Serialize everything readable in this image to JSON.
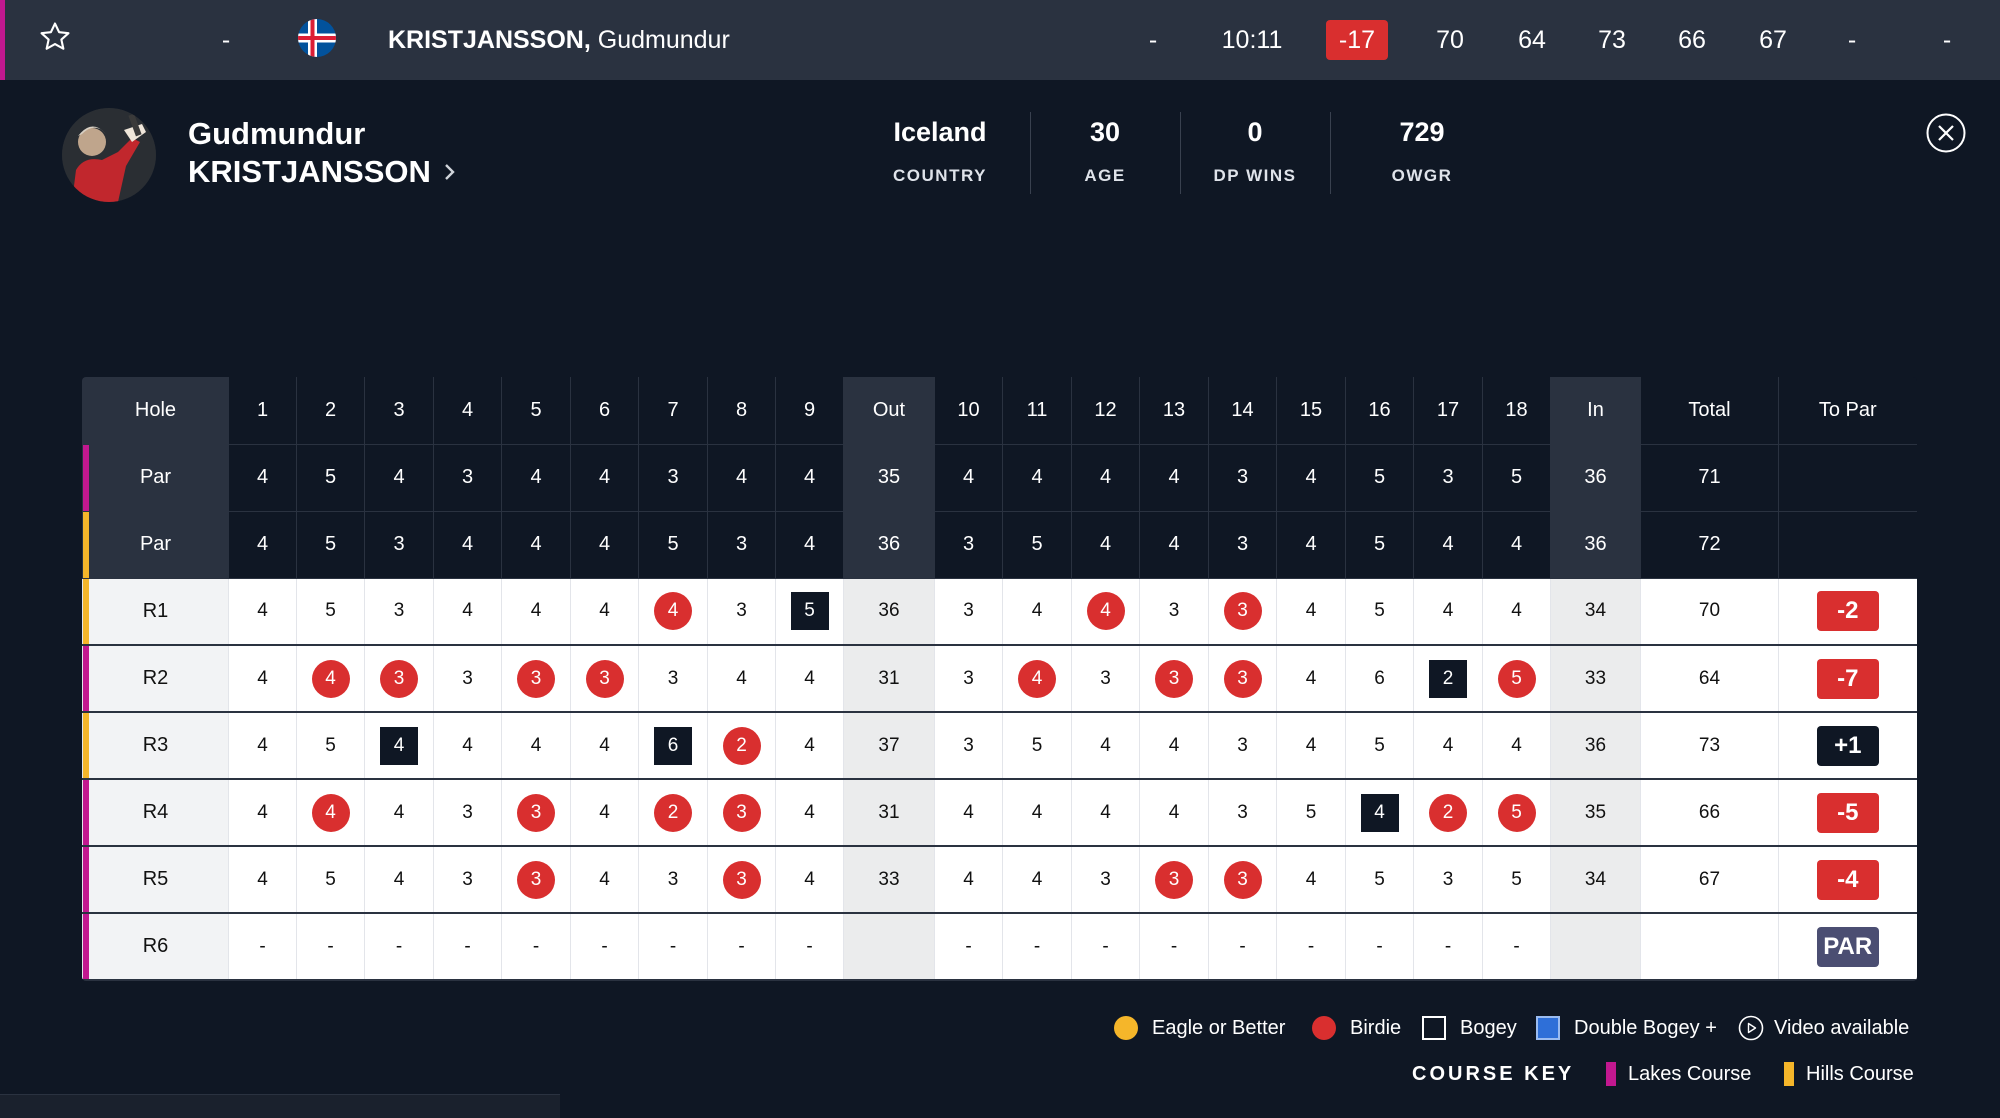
{
  "top_row": {
    "position": "-",
    "name_last": "KRISTJANSSON,",
    "name_first": "Gudmundur",
    "thru": "-",
    "time": "10:11",
    "to_par": "-17",
    "r1": "70",
    "r2": "64",
    "r3": "73",
    "r4": "66",
    "r5": "67",
    "r6": "-",
    "total": "-"
  },
  "player": {
    "first_name": "Gudmundur",
    "last_name": "KRISTJANSSON",
    "stats": [
      {
        "value": "Iceland",
        "label": "COUNTRY"
      },
      {
        "value": "30",
        "label": "AGE"
      },
      {
        "value": "0",
        "label": "DP WINS"
      },
      {
        "value": "729",
        "label": "OWGR"
      }
    ]
  },
  "scorecard": {
    "header": [
      "Hole",
      "1",
      "2",
      "3",
      "4",
      "5",
      "6",
      "7",
      "8",
      "9",
      "Out",
      "10",
      "11",
      "12",
      "13",
      "14",
      "15",
      "16",
      "17",
      "18",
      "In",
      "Total",
      "To Par"
    ],
    "par_rows": [
      {
        "label": "Par",
        "course": "lakes",
        "cells": [
          "4",
          "5",
          "4",
          "3",
          "4",
          "4",
          "3",
          "4",
          "4",
          "35",
          "4",
          "4",
          "4",
          "4",
          "3",
          "4",
          "5",
          "3",
          "5",
          "36",
          "71",
          ""
        ]
      },
      {
        "label": "Par",
        "course": "hills",
        "cells": [
          "4",
          "5",
          "3",
          "4",
          "4",
          "4",
          "5",
          "3",
          "4",
          "36",
          "3",
          "5",
          "4",
          "4",
          "3",
          "4",
          "5",
          "4",
          "4",
          "36",
          "72",
          ""
        ]
      }
    ],
    "rounds": [
      {
        "label": "R1",
        "course": "hills",
        "cells": [
          "4",
          "5",
          "3",
          "4",
          "4",
          "4",
          "4",
          "3",
          "5",
          "36",
          "3",
          "4",
          "4",
          "3",
          "3",
          "4",
          "5",
          "4",
          "4",
          "34",
          "70"
        ],
        "marks": [
          "",
          "",
          "",
          "",
          "",
          "",
          "b",
          "",
          "g",
          "",
          "",
          "b",
          "",
          "b",
          "",
          "",
          "",
          "",
          ""
        ],
        "to_par": "-2",
        "tp": "under"
      },
      {
        "label": "R2",
        "course": "lakes",
        "cells": [
          "4",
          "4",
          "3",
          "3",
          "3",
          "3",
          "3",
          "4",
          "4",
          "31",
          "3",
          "4",
          "3",
          "3",
          "3",
          "4",
          "6",
          "2",
          "5",
          "33",
          "64"
        ],
        "marks": [
          "",
          "b",
          "b",
          "",
          "b",
          "b",
          "",
          "",
          "",
          "",
          "b",
          "",
          "b",
          "b",
          "",
          "",
          "g",
          "b",
          ""
        ],
        "to_par": "-7",
        "tp": "under"
      },
      {
        "label": "R3",
        "course": "hills",
        "cells": [
          "4",
          "5",
          "4",
          "4",
          "4",
          "4",
          "6",
          "2",
          "4",
          "37",
          "3",
          "5",
          "4",
          "4",
          "3",
          "4",
          "5",
          "4",
          "4",
          "36",
          "73"
        ],
        "marks": [
          "",
          "",
          "g",
          "",
          "",
          "",
          "g",
          "b",
          "",
          "",
          "",
          "",
          "",
          "",
          "",
          "",
          "",
          "",
          ""
        ],
        "to_par": "+1",
        "tp": "over"
      },
      {
        "label": "R4",
        "course": "lakes",
        "cells": [
          "4",
          "4",
          "4",
          "3",
          "3",
          "4",
          "2",
          "3",
          "4",
          "31",
          "4",
          "4",
          "4",
          "4",
          "3",
          "5",
          "4",
          "2",
          "5",
          "35",
          "66"
        ],
        "marks": [
          "",
          "b",
          "",
          "",
          "b",
          "",
          "b",
          "b",
          "",
          "",
          "",
          "",
          "",
          "",
          "",
          "g",
          "b",
          "b",
          ""
        ],
        "to_par": "-5",
        "tp": "under"
      },
      {
        "label": "R5",
        "course": "lakes",
        "cells": [
          "4",
          "5",
          "4",
          "3",
          "3",
          "4",
          "3",
          "3",
          "4",
          "33",
          "4",
          "4",
          "3",
          "3",
          "3",
          "4",
          "5",
          "3",
          "5",
          "34",
          "67"
        ],
        "marks": [
          "",
          "",
          "",
          "",
          "b",
          "",
          "",
          "b",
          "",
          "",
          "",
          "",
          "b",
          "b",
          "",
          "",
          "",
          "",
          ""
        ],
        "to_par": "-4",
        "tp": "under"
      },
      {
        "label": "R6",
        "course": "lakes",
        "cells": [
          "-",
          "-",
          "-",
          "-",
          "-",
          "-",
          "-",
          "-",
          "-",
          "",
          "-",
          "-",
          "-",
          "-",
          "-",
          "-",
          "-",
          "-",
          "-",
          "",
          ""
        ],
        "marks": [
          "",
          "",
          "",
          "",
          "",
          "",
          "",
          "",
          "",
          "",
          "",
          "",
          "",
          "",
          "",
          "",
          "",
          "",
          ""
        ],
        "to_par": "PAR",
        "tp": "even"
      }
    ]
  },
  "legend": {
    "eagle": "Eagle or Better",
    "birdie": "Birdie",
    "bogey": "Bogey",
    "double_bogey": "Double Bogey +",
    "video": "Video available",
    "course_key": "COURSE KEY",
    "lakes": "Lakes Course",
    "hills": "Hills Course"
  },
  "colors": {
    "lakes": "#c2188f",
    "hills": "#f5b62a",
    "birdie": "#d92f2f",
    "eagle": "#f5b62a",
    "double_bogey": "#2e6fd8",
    "bogey": "#0f1724"
  }
}
